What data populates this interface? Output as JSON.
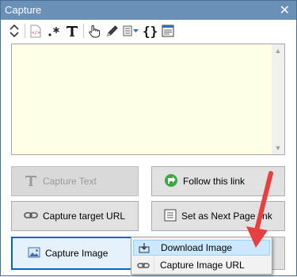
{
  "window": {
    "title": "Capture",
    "close_glyph": "✕"
  },
  "toolbar": {
    "icons": [
      "expand-collapse-icon",
      "html-source-icon",
      "regex-icon",
      "text-icon",
      "hand-pointer-icon",
      "pencil-icon",
      "dropdown-list-icon",
      "braces-icon",
      "form-icon"
    ]
  },
  "editor": {
    "value": "",
    "placeholder": ""
  },
  "buttons": {
    "capture_text": "Capture Text",
    "follow_link": "Follow this link",
    "capture_target_url": "Capture target URL",
    "set_next_page": "Set as Next Page link",
    "capture_image": "Capture Image"
  },
  "menu": {
    "items": [
      {
        "label": "Download Image",
        "icon": "download-icon",
        "highlighted": true
      },
      {
        "label": "Capture Image URL",
        "icon": "chain-link-icon",
        "highlighted": false
      }
    ]
  },
  "colors": {
    "titlebar": "#6a90b8",
    "editor_bg": "#ffffe6",
    "arrow": "#e84040",
    "menu_highlight": "#cce8ff"
  }
}
